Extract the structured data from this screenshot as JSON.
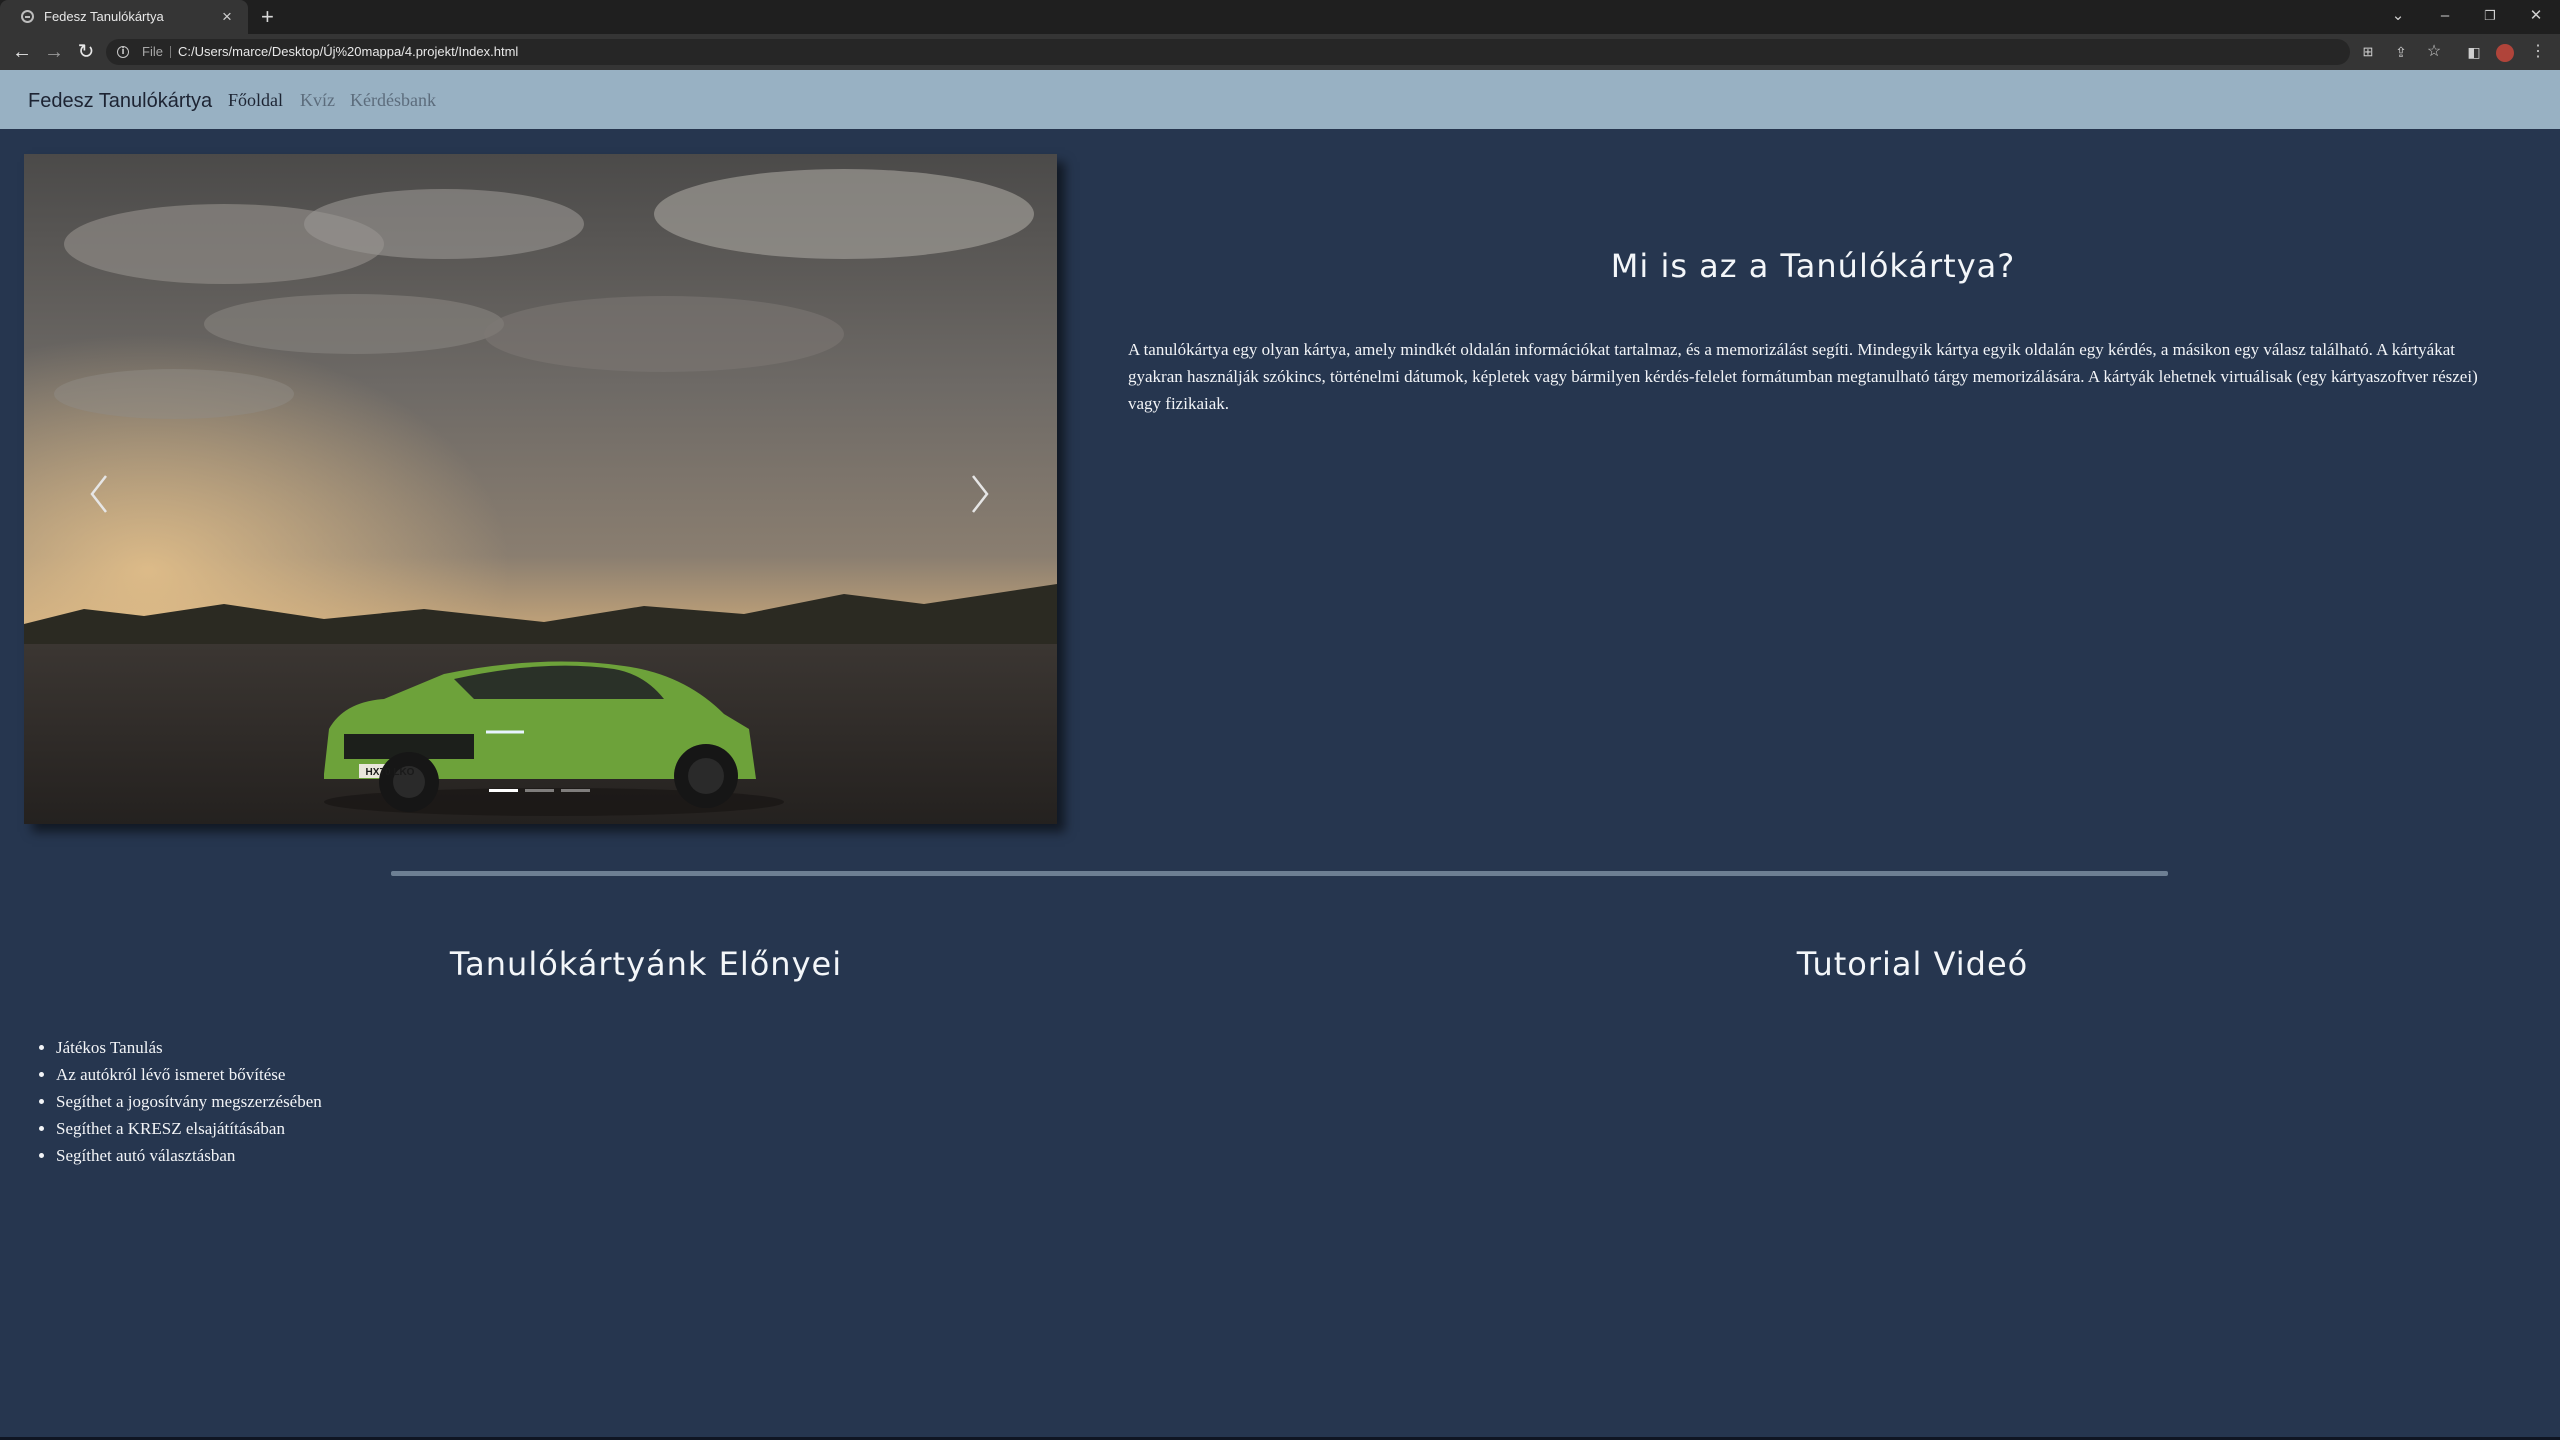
{
  "browser": {
    "tab_title": "Fedesz Tanulókártya",
    "tab_close": "×",
    "new_tab": "+",
    "address_prefix": "File",
    "url": "C:/Users/marce/Desktop/Új%20mappa/4.projekt/Index.html"
  },
  "navbar": {
    "brand": "Fedesz Tanulókártya",
    "links": [
      "Főoldal",
      "Kvíz",
      "Kérdésbank"
    ]
  },
  "carousel": {
    "slide_count": 3,
    "active_index": 0,
    "plate_text": "HX70 LKO"
  },
  "intro": {
    "heading": "Mi is az a Tanúlókártya?",
    "text": "A tanulókártya egy olyan kártya, amely mindkét oldalán információkat tartalmaz, és a memorizálást segíti. Mindegyik kártya egyik oldalán egy kérdés, a másikon egy válasz található. A kártyákat gyakran használják szókincs, történelmi dátumok, képletek vagy bármilyen kérdés-felelet formátumban megtanulható tárgy memorizálására. A kártyák lehetnek virtuálisak (egy kártyaszoftver részei) vagy fizikaiak."
  },
  "benefits": {
    "heading": "Tanulókártyánk Előnyei",
    "items": [
      "Játékos Tanulás",
      "Az autókról lévő ismeret bővítése",
      "Segíthet a jogosítvány megszerzésében",
      "Segíthet a KRESZ elsajátításában",
      "Segíthet autó választásban"
    ]
  },
  "video": {
    "heading": "Tutorial Videó"
  }
}
